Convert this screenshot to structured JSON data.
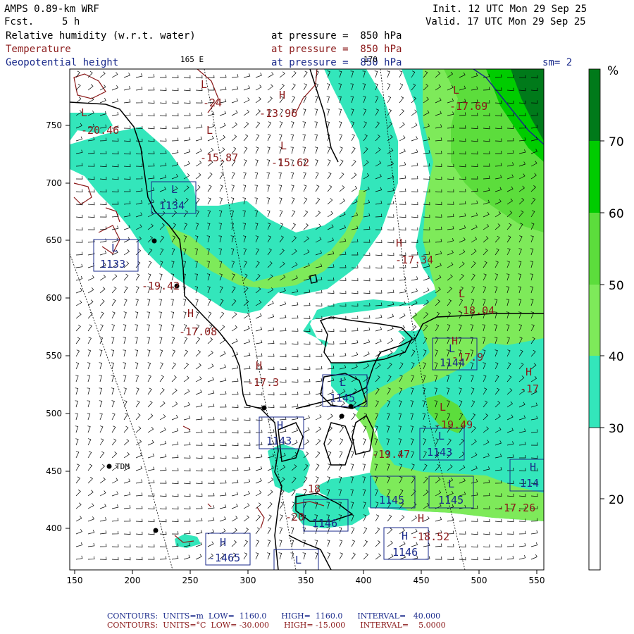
{
  "header": {
    "model": "AMPS 0.89-km WRF",
    "fcst_label": "Fcst.",
    "fcst_value": "5 h",
    "init": "Init. 12 UTC Mon 29 Sep 25",
    "valid": "Valid. 17 UTC Mon 29 Sep 25",
    "var1": "Relative humidity (w.r.t. water)",
    "var2": "Temperature",
    "var3": "Geopotential height",
    "pressure_line": "at pressure =  850 hPa",
    "top_lon1": "165 E",
    "top_lon2": "170",
    "sm": "sm= 2"
  },
  "colors": {
    "rh_20_30": "#ffffff",
    "rh_30_40": "#33e6bb",
    "rh_40_50": "#7eea5a",
    "rh_50_60": "#5cdd3c",
    "rh_60_70": "#00cc00",
    "rh_70_plus": "#007a1a",
    "temp": "#8b1a1a",
    "height": "#1a2a8b"
  },
  "colorbar": {
    "unit": "%",
    "labels": [
      "70",
      "60",
      "50",
      "40",
      "30",
      "20"
    ]
  },
  "axes": {
    "x_ticks": [
      "150",
      "200",
      "250",
      "300",
      "350",
      "400",
      "450",
      "500",
      "550"
    ],
    "y_ticks": [
      "750",
      "700",
      "650",
      "600",
      "550",
      "500",
      "450",
      "400"
    ]
  },
  "labels": {
    "temp": [
      {
        "t": "L"
      },
      {
        "t": "-24"
      },
      {
        "t": "H"
      },
      {
        "t": "-13.96"
      },
      {
        "t": "L"
      },
      {
        "t": "-15.87"
      },
      {
        "t": "L"
      },
      {
        "t": "-15.62"
      },
      {
        "t": "L"
      },
      {
        "t": "-17.69"
      },
      {
        "t": "L"
      },
      {
        "t": "-20.46"
      },
      {
        "t": "H"
      },
      {
        "t": "-17.34"
      },
      {
        "t": "L"
      },
      {
        "t": "-18.04"
      },
      {
        "t": "-19.42"
      },
      {
        "t": "H"
      },
      {
        "t": "-17.08"
      },
      {
        "t": "H"
      },
      {
        "t": "-17.3"
      },
      {
        "t": "H"
      },
      {
        "t": "-17.9"
      },
      {
        "t": "H"
      },
      {
        "t": "-17"
      },
      {
        "t": "L"
      },
      {
        "t": "-19.49"
      },
      {
        "t": "-19.47"
      },
      {
        "t": "-17.26"
      },
      {
        "t": "-18"
      },
      {
        "t": "-20"
      },
      {
        "t": "H"
      },
      {
        "t": "-18.52"
      }
    ],
    "height": [
      {
        "t": "L"
      },
      {
        "t": "1134"
      },
      {
        "t": "L"
      },
      {
        "t": "1133"
      },
      {
        "t": "L"
      },
      {
        "t": "1144"
      },
      {
        "t": "L"
      },
      {
        "t": "1145"
      },
      {
        "t": "H"
      },
      {
        "t": "1143"
      },
      {
        "t": "L"
      },
      {
        "t": "1143"
      },
      {
        "t": "1145"
      },
      {
        "t": "L"
      },
      {
        "t": "1145"
      },
      {
        "t": "H"
      },
      {
        "t": "114"
      },
      {
        "t": "1146"
      },
      {
        "t": "H"
      },
      {
        "t": "1146"
      },
      {
        "t": "H"
      },
      {
        "t": "-1465"
      },
      {
        "t": "L"
      }
    ],
    "station": "TDM"
  },
  "footer": {
    "row1": {
      "label": "CONTOURS:",
      "units": "UNITS=m",
      "low": "LOW=  1160.0",
      "high": "HIGH=  1160.0",
      "interval": "INTERVAL=   40.000"
    },
    "row2": {
      "label": "CONTOURS:",
      "units": "UNITS=°C",
      "low": "LOW= -30.000",
      "high": "HIGH= -15.000",
      "interval": "INTERVAL=    5.0000"
    }
  }
}
